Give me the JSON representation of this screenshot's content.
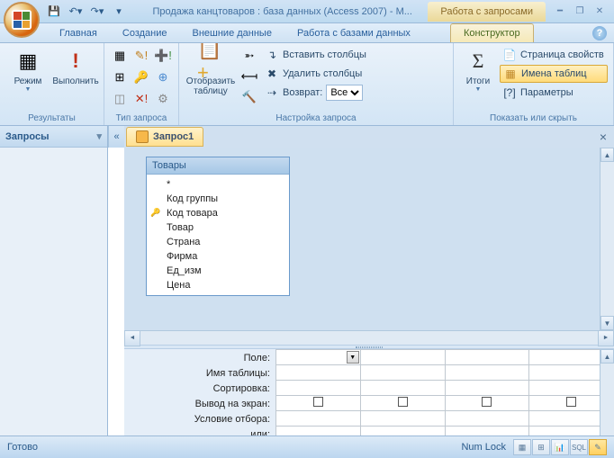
{
  "window": {
    "title": "Продажа канцтоваров : база данных (Access 2007) - M...",
    "contextual_title": "Работа с запросами"
  },
  "tabs": {
    "home": "Главная",
    "create": "Создание",
    "external": "Внешние данные",
    "dbtools": "Работа с базами данных",
    "design": "Конструктор"
  },
  "ribbon": {
    "results": {
      "mode": "Режим",
      "run": "Выполнить",
      "label": "Результаты"
    },
    "querytype": {
      "label": "Тип запроса"
    },
    "querysetup": {
      "showtable": "Отобразить таблицу",
      "insert_cols": "Вставить столбцы",
      "delete_cols": "Удалить столбцы",
      "return_lbl": "Возврат:",
      "return_val": "Все",
      "label": "Настройка запроса"
    },
    "showhide": {
      "totals": "Итоги",
      "propsheet": "Страница свойств",
      "tablenames": "Имена таблиц",
      "params": "Параметры",
      "label": "Показать или скрыть"
    }
  },
  "nav": {
    "header": "Запросы"
  },
  "doc": {
    "tab": "Запрос1"
  },
  "table_box": {
    "name": "Товары",
    "fields": [
      "*",
      "Код группы",
      "Код товара",
      "Товар",
      "Страна",
      "Фирма",
      "Ед_изм",
      "Цена"
    ],
    "key_index": 2
  },
  "qbe": {
    "labels": [
      "Поле:",
      "Имя таблицы:",
      "Сортировка:",
      "Вывод на экран:",
      "Условие отбора:",
      "или:"
    ]
  },
  "status": {
    "ready": "Готово",
    "numlock": "Num Lock",
    "sql": "SQL"
  }
}
